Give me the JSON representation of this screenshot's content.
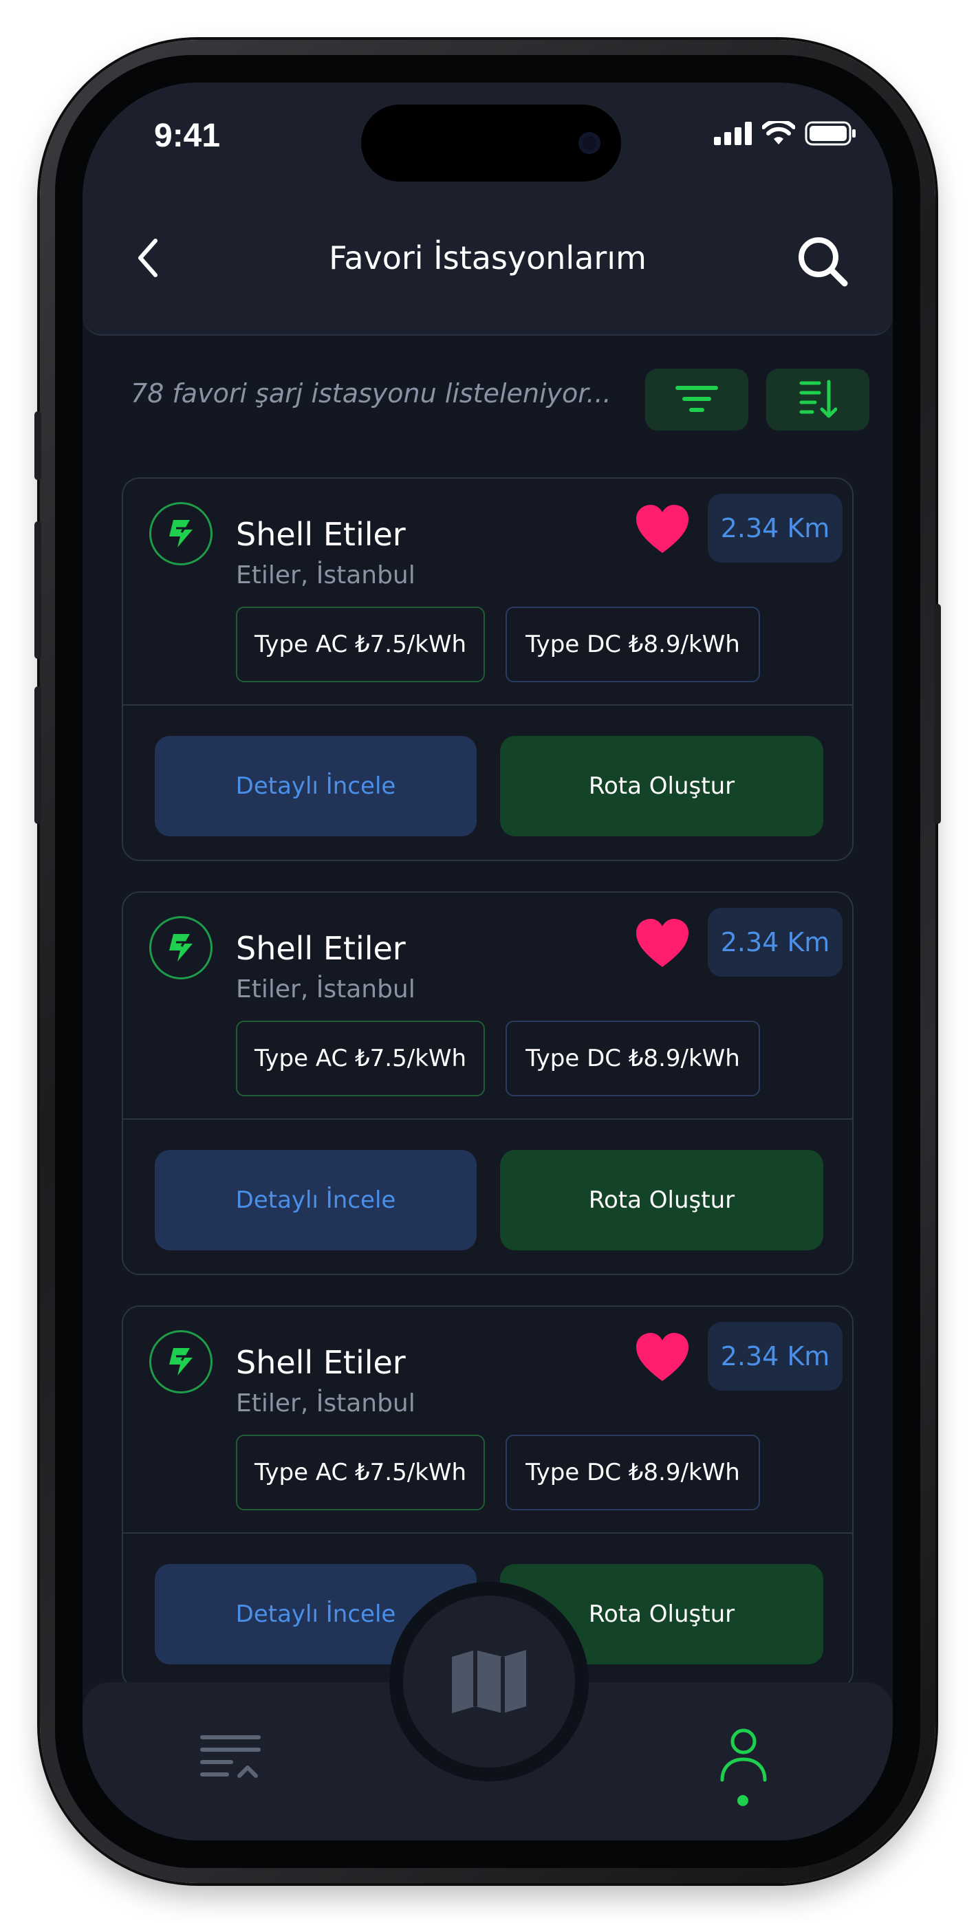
{
  "status_bar": {
    "time": "9:41"
  },
  "header": {
    "title": "Favori İstasyonlarım"
  },
  "summary": {
    "text": "78 favori şarj istasyonu listeleniyor..."
  },
  "stations": [
    {
      "name": "Shell Etiler",
      "location": "Etiler, İstanbul",
      "distance": "2.34 Km",
      "tags": [
        "Type AC ₺7.5/kWh",
        "Type DC ₺8.9/kWh"
      ],
      "detail_label": "Detaylı İncele",
      "route_label": "Rota Oluştur"
    },
    {
      "name": "Shell Etiler",
      "location": "Etiler, İstanbul",
      "distance": "2.34 Km",
      "tags": [
        "Type AC ₺7.5/kWh",
        "Type DC ₺8.9/kWh"
      ],
      "detail_label": "Detaylı İncele",
      "route_label": "Rota Oluştur"
    },
    {
      "name": "Shell Etiler",
      "location": "Etiler, İstanbul",
      "distance": "2.34 Km",
      "tags": [
        "Type AC ₺7.5/kWh",
        "Type DC ₺8.9/kWh"
      ],
      "detail_label": "Detaylı İncele",
      "route_label": "Rota Oluştur"
    }
  ],
  "icons": {
    "back": "chevron-left-icon",
    "search": "search-icon",
    "filter": "filter-icon",
    "sort": "sort-icon",
    "favorite": "heart-icon",
    "station_logo": "charging-bolt-icon",
    "nav_list": "list-icon",
    "nav_map": "map-icon",
    "nav_profile": "user-icon"
  },
  "colors": {
    "background": "#131722",
    "accent_green": "#1fcf4e",
    "accent_blue": "#4a8fe8",
    "heart_pink": "#ff1e6e"
  }
}
